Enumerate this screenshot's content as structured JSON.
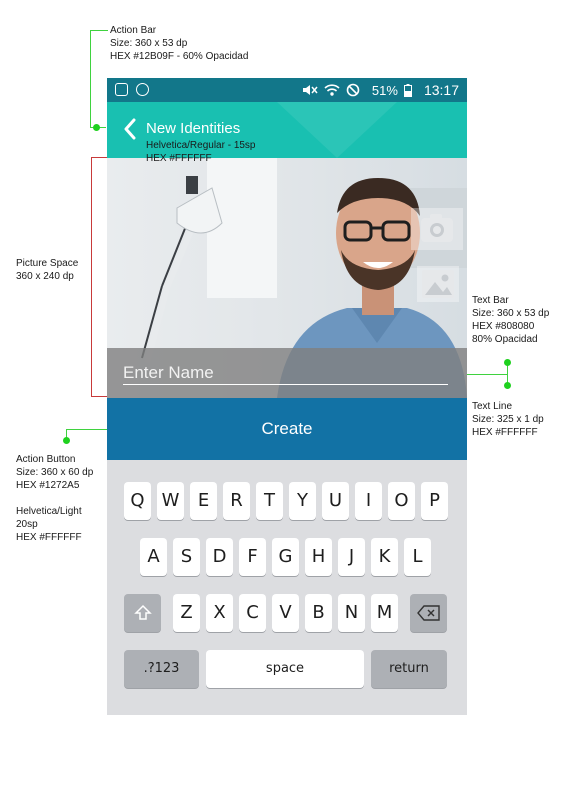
{
  "annotations": {
    "action_bar": [
      "Action Bar",
      "Size: 360 x 53 dp",
      "HEX #12B09F - 60% Opacidad"
    ],
    "title_font": [
      "Helvetica/Regular - 15sp",
      "HEX #FFFFFF"
    ],
    "picture_space": [
      "Picture Space",
      "360 x 240 dp"
    ],
    "text_bar": [
      "Text Bar",
      "Size: 360 x 53 dp",
      "HEX #808080",
      "80% Opacidad"
    ],
    "text_line": [
      "Text Line",
      "Size: 325 x 1 dp",
      "HEX #FFFFFF"
    ],
    "action_button": [
      "Action Button",
      "Size: 360 x 60 dp",
      "HEX #1272A5",
      "",
      "Helvetica/Light",
      "20sp",
      "HEX #FFFFFF"
    ]
  },
  "status_bar": {
    "battery": "51%",
    "time": "13:17",
    "icons": [
      "screenshot-icon",
      "app-icon",
      "mute-icon",
      "wifi-icon",
      "no-sync-icon",
      "battery-icon"
    ]
  },
  "action_bar": {
    "title": "New Identities",
    "back_icon": "chevron-left-icon"
  },
  "picture": {
    "camera_icon": "camera-icon",
    "gallery_icon": "image-icon"
  },
  "name_field": {
    "placeholder": "Enter Name",
    "value": ""
  },
  "create_button": {
    "label": "Create"
  },
  "keyboard": {
    "row1": [
      "Q",
      "W",
      "E",
      "R",
      "T",
      "Y",
      "U",
      "I",
      "O",
      "P"
    ],
    "row2": [
      "A",
      "S",
      "D",
      "F",
      "G",
      "H",
      "J",
      "K",
      "L"
    ],
    "row3": [
      "Z",
      "X",
      "C",
      "V",
      "B",
      "N",
      "M"
    ],
    "numbers_label": ".?123",
    "space_label": "space",
    "return_label": "return"
  },
  "colors": {
    "status_bar": "#12778A",
    "action_bar": "#19C0B1",
    "text_bar": "#808080",
    "action_button": "#1272A5",
    "annotation_line": "#3FD23F"
  }
}
